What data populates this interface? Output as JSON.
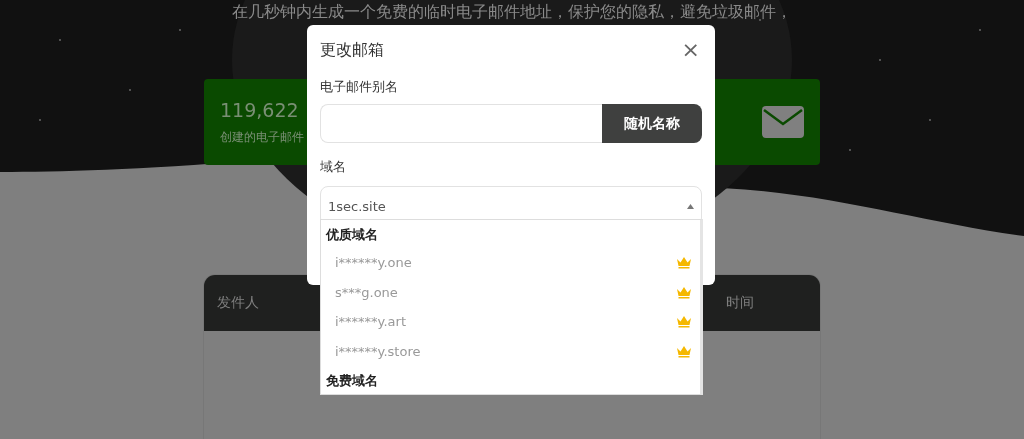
{
  "page": {
    "subtitle": "在几秒钟内生成一个免费的临时电子邮件地址，保护您的隐私，避免垃圾邮件，",
    "stats": {
      "count": "119,622",
      "label": "创建的电子邮件"
    },
    "table": {
      "columns": [
        "发件人",
        "时间"
      ]
    }
  },
  "dialog": {
    "title": "更改邮箱",
    "close": "×",
    "alias": {
      "label": "电子邮件别名",
      "button": "随机名称"
    },
    "domain": {
      "label": "域名",
      "value": "1sec.site",
      "expanded": true,
      "groups": [
        {
          "label": "优质域名",
          "options": [
            {
              "name": "i******y.one",
              "premium": true
            },
            {
              "name": "s***g.one",
              "premium": true
            },
            {
              "name": "i******y.art",
              "premium": true
            },
            {
              "name": "i******y.store",
              "premium": true
            }
          ]
        },
        {
          "label": "免费域名"
        }
      ]
    }
  }
}
